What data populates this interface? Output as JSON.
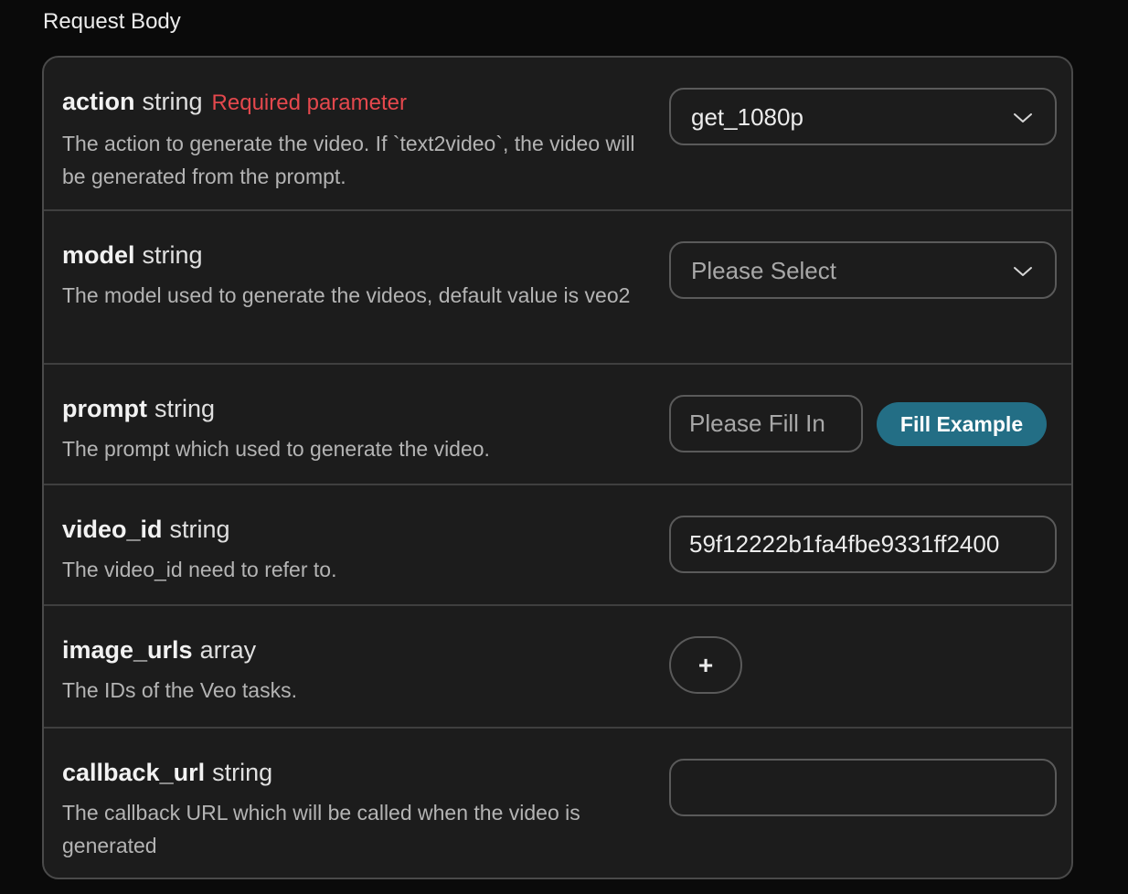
{
  "section_title": "Request Body",
  "params": {
    "action": {
      "name": "action",
      "type": "string",
      "required_label": "Required parameter",
      "description": "The action to generate the video. If `text2video`, the video will be generated from the prompt.",
      "value": "get_1080p"
    },
    "model": {
      "name": "model",
      "type": "string",
      "description": "The model used to generate the videos, default value is veo2",
      "placeholder": "Please Select"
    },
    "prompt": {
      "name": "prompt",
      "type": "string",
      "description": "The prompt which used to generate the video.",
      "placeholder": "Please Fill In",
      "fill_example_label": "Fill Example"
    },
    "video_id": {
      "name": "video_id",
      "type": "string",
      "description": "The video_id need to refer to.",
      "value": "59f12222b1fa4fbe9331ff2400"
    },
    "image_urls": {
      "name": "image_urls",
      "type": "array",
      "description": "The IDs of the Veo tasks.",
      "add_label": "+"
    },
    "callback_url": {
      "name": "callback_url",
      "type": "string",
      "description": "The callback URL which will be called when the video is generated",
      "value": ""
    }
  },
  "icons": {
    "dropdown": "chevron-down-icon"
  },
  "colors": {
    "required": "#e5484d",
    "accent_button": "#236e85"
  }
}
